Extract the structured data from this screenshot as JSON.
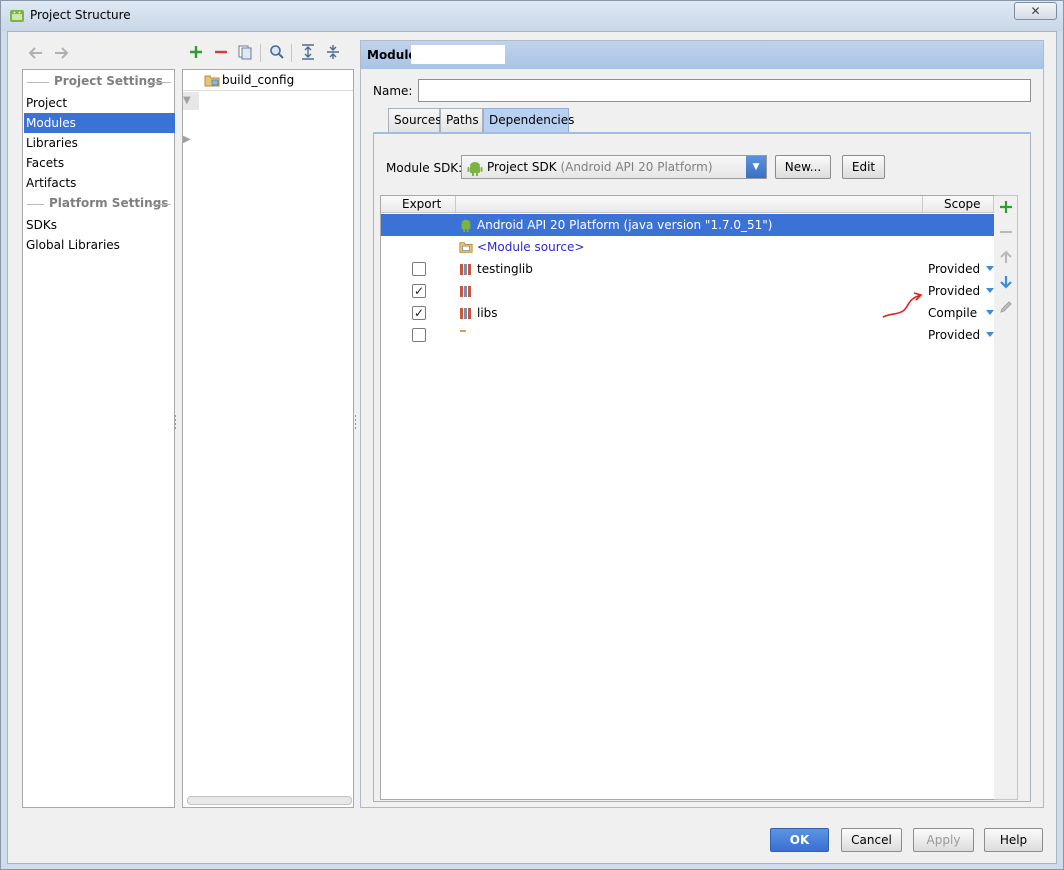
{
  "window": {
    "title": "Project Structure",
    "close_label": "✕"
  },
  "nav": {
    "project_settings_header": "Project Settings",
    "platform_settings_header": "Platform Settings",
    "items_project": [
      "Project",
      "Modules",
      "Libraries",
      "Facets",
      "Artifacts"
    ],
    "items_platform": [
      "SDKs",
      "Global Libraries"
    ],
    "selected": "Modules"
  },
  "tree": {
    "items": [
      {
        "label": "build_config"
      }
    ]
  },
  "module": {
    "header_label": "Module",
    "name_label": "Name:",
    "name_value": "",
    "tabs": [
      "Sources",
      "Paths",
      "Dependencies"
    ],
    "active_tab": "Dependencies",
    "sdk_label": "Module SDK:",
    "sdk_value": "Project SDK",
    "sdk_detail": "(Android API 20 Platform)",
    "new_button": "New...",
    "edit_button": "Edit"
  },
  "dependencies": {
    "columns": {
      "export": "Export",
      "scope": "Scope"
    },
    "rows": [
      {
        "name": "Android API 20 Platform (java version \"1.7.0_51\")",
        "scope": "",
        "checkbox": false,
        "checked": false,
        "selected": true,
        "icon": "android-icon"
      },
      {
        "name": "<Module source>",
        "scope": "",
        "checkbox": false,
        "checked": false,
        "selected": false,
        "icon": "module-source-icon"
      },
      {
        "name": "testinglib",
        "scope": "Provided",
        "checkbox": true,
        "checked": false,
        "selected": false,
        "icon": "library-icon"
      },
      {
        "name": "",
        "scope": "Provided",
        "checkbox": true,
        "checked": true,
        "selected": false,
        "icon": "library-icon"
      },
      {
        "name": "libs",
        "scope": "Compile",
        "checkbox": true,
        "checked": true,
        "selected": false,
        "icon": "library-icon"
      },
      {
        "name": "",
        "scope": "Provided",
        "checkbox": true,
        "checked": false,
        "selected": false,
        "icon": "library-icon"
      }
    ]
  },
  "footer": {
    "ok": "OK",
    "cancel": "Cancel",
    "apply": "Apply",
    "help": "Help"
  },
  "colors": {
    "selection": "#3b72d6",
    "header_bg": "#b9d1f0",
    "annotation": "#e02020"
  }
}
